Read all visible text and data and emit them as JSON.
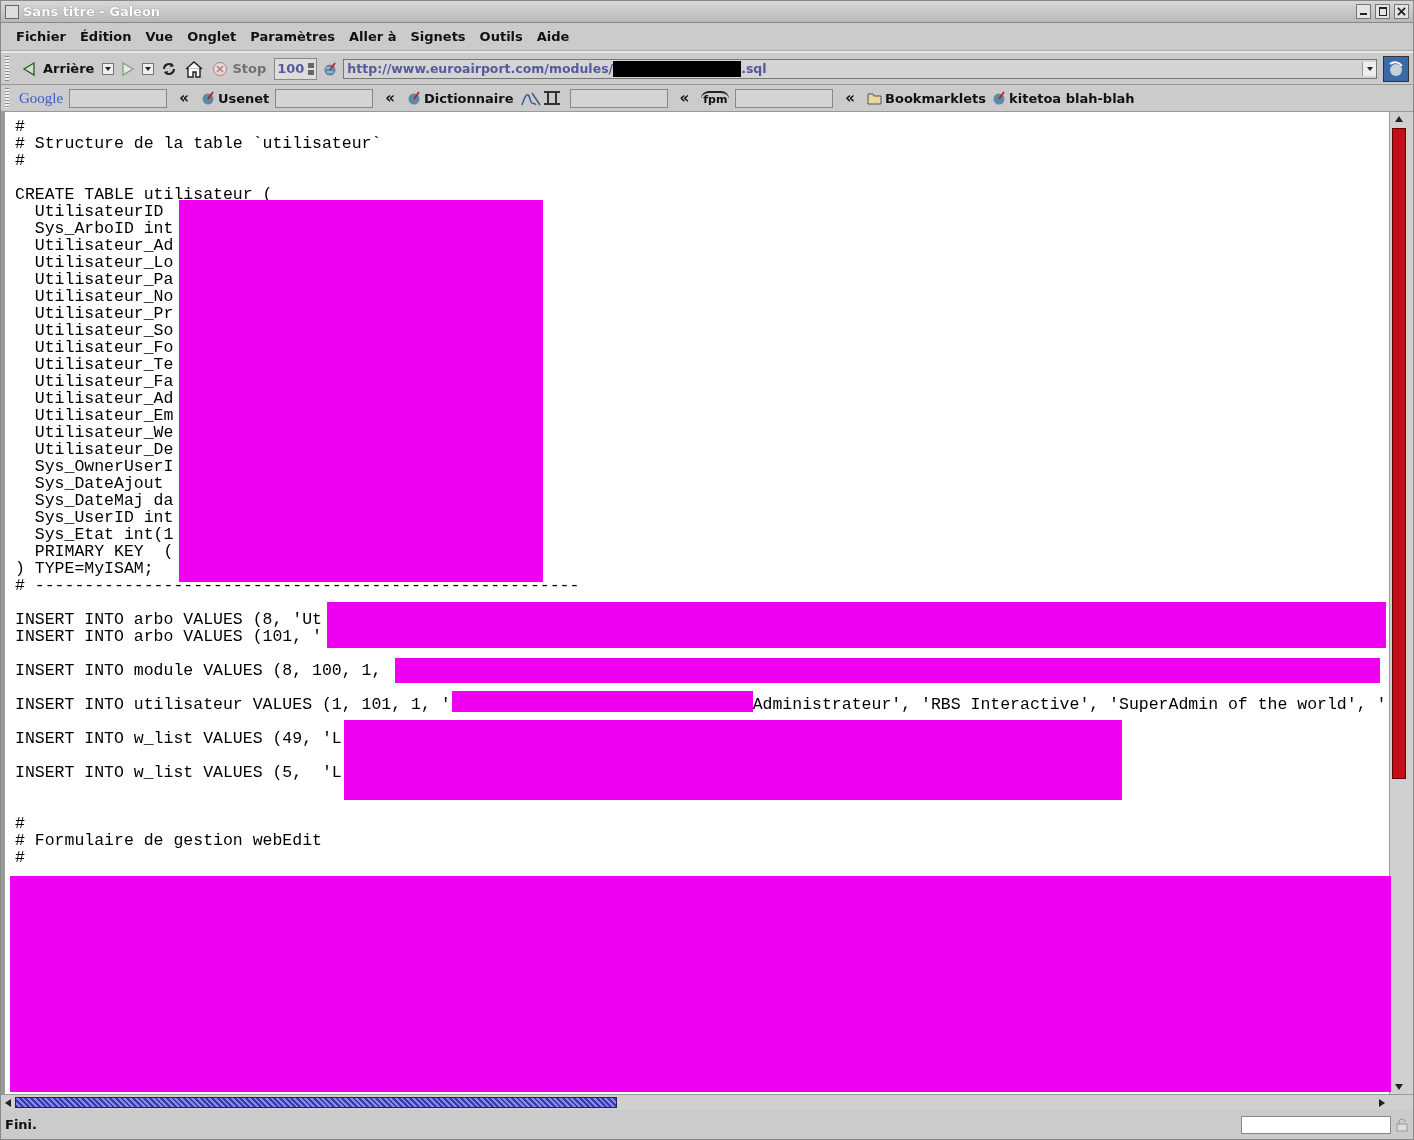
{
  "window": {
    "title": "Sans titre - Galeon"
  },
  "menu_bar": [
    "Fichier",
    "Édition",
    "Vue",
    "Onglet",
    "Paramètres",
    "Aller à",
    "Signets",
    "Outils",
    "Aide"
  ],
  "toolbar": {
    "back_label": "Arrière",
    "stop_label": "Stop",
    "zoom": "100",
    "url_prefix": "http://www.euroairport.com/modules/",
    "url_suffix": ".sql"
  },
  "bookmarks_bar": [
    {
      "kind": "logo_search",
      "label": "Google"
    },
    {
      "kind": "search",
      "chevron": "«",
      "label": "Usenet"
    },
    {
      "kind": "search",
      "chevron": "«",
      "label": "Dictionnaire"
    },
    {
      "kind": "logo_search",
      "chevron": "«",
      "label": "fpm"
    },
    {
      "kind": "folder",
      "chevron": "«",
      "label": "Bookmarklets"
    },
    {
      "kind": "link",
      "label": "kitetoa blah-blah"
    }
  ],
  "code_blocks": [
    {
      "lines": [
        {
          "text": "#"
        },
        {
          "text": "# Structure de la table `utilisateur`"
        },
        {
          "text": "#"
        }
      ]
    },
    {
      "lines": [
        {
          "text": "CREATE TABLE utilisateur ("
        },
        {
          "text": "  UtilisateurID"
        },
        {
          "text": "  Sys_ArboID int"
        },
        {
          "text": "  Utilisateur_Ad"
        },
        {
          "text": "  Utilisateur_Lo"
        },
        {
          "text": "  Utilisateur_Pa"
        },
        {
          "text": "  Utilisateur_No"
        },
        {
          "text": "  Utilisateur_Pr"
        },
        {
          "text": "  Utilisateur_So"
        },
        {
          "text": "  Utilisateur_Fo"
        },
        {
          "text": "  Utilisateur_Te"
        },
        {
          "text": "  Utilisateur_Fa"
        },
        {
          "text": "  Utilisateur_Ad"
        },
        {
          "text": "  Utilisateur_Em"
        },
        {
          "text": "  Utilisateur_We"
        },
        {
          "text": "  Utilisateur_De"
        },
        {
          "text": "  Sys_OwnerUserI"
        },
        {
          "text": "  Sys_DateAjout"
        },
        {
          "text": "  Sys_DateMaj da"
        },
        {
          "text": "  Sys_UserID int"
        },
        {
          "text": "  Sys_Etat int(1"
        },
        {
          "text": "  PRIMARY KEY  ("
        },
        {
          "text": ") TYPE=MyISAM;"
        },
        {
          "text": "# -------------------------------------------------------"
        }
      ]
    },
    {
      "lines": [
        {
          "text": "INSERT INTO arbo VALUES (8, 'Ut"
        },
        {
          "text": "INSERT INTO arbo VALUES (101, '"
        }
      ]
    },
    {
      "lines": [
        {
          "text": "INSERT INTO module VALUES (8, 100, 1,"
        }
      ]
    },
    {
      "lines": [
        {
          "text": "INSERT INTO utilisateur VALUES (1, 101, 1, '",
          "tail": "Administrateur', 'RBS Interactive', 'SuperAdmin of the world', '"
        }
      ]
    },
    {
      "lines": [
        {
          "text": "INSERT INTO w_list VALUES (49, 'L"
        }
      ]
    },
    {
      "lines": [
        {
          "text": "INSERT INTO w_list VALUES (5,  'L"
        }
      ]
    },
    {
      "wide_gap": true,
      "lines": [
        {
          "text": "#"
        },
        {
          "text": "# Formulaire de gestion webEdit"
        },
        {
          "text": "#"
        }
      ]
    }
  ],
  "status_bar": {
    "text": "Fini."
  }
}
